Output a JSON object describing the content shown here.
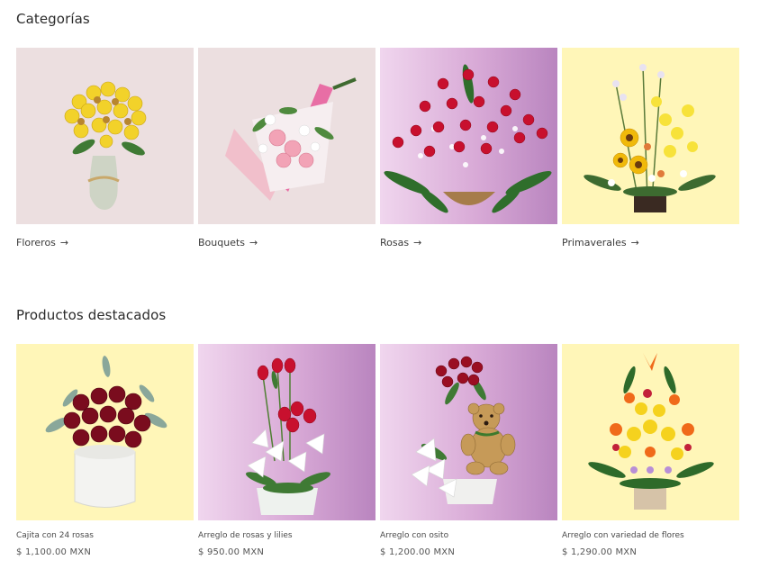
{
  "categories": {
    "title": "Categorías",
    "items": [
      {
        "label": "Floreros",
        "arrow": "→"
      },
      {
        "label": "Bouquets",
        "arrow": "→"
      },
      {
        "label": "Rosas",
        "arrow": "→"
      },
      {
        "label": "Primaverales",
        "arrow": "→"
      }
    ]
  },
  "featured": {
    "title": "Productos destacados",
    "items": [
      {
        "name": "Cajita con 24 rosas",
        "price": "$ 1,100.00 MXN"
      },
      {
        "name": "Arreglo de rosas y lilies",
        "price": "$ 950.00 MXN"
      },
      {
        "name": "Arreglo con osito",
        "price": "$ 1,200.00 MXN"
      },
      {
        "name": "Arreglo con variedad de flores",
        "price": "$ 1,290.00 MXN"
      }
    ]
  },
  "colors": {
    "pink_bg": "#ecdfe0",
    "purple_bg": "#d8a9d6",
    "yellow_bg": "#fff6b8",
    "text": "#3a3a3a"
  },
  "icons": {
    "arrow": "arrow-right-icon"
  }
}
